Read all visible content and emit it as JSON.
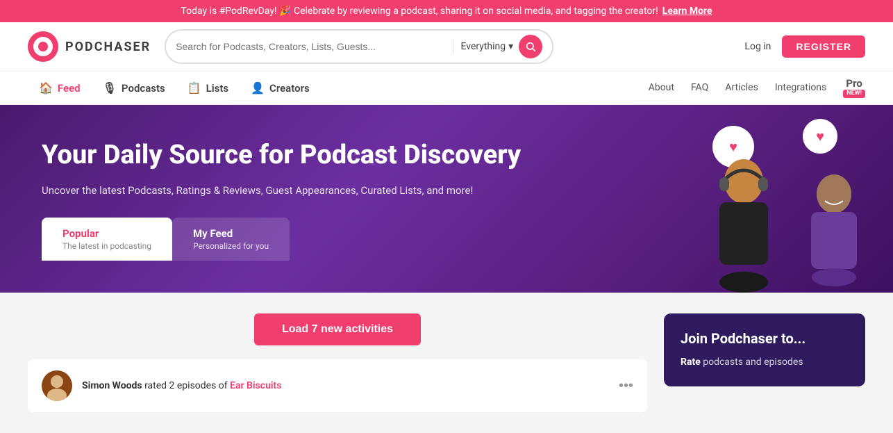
{
  "banner": {
    "text": "Today is #PodRevDay! 🎉 Celebrate by reviewing a podcast, sharing it on social media, and tagging the creator!",
    "link_text": "Learn More"
  },
  "header": {
    "logo_text": "PODCHASER",
    "search_placeholder": "Search for Podcasts, Creators, Lists, Guests...",
    "filter_label": "Everything",
    "login_label": "Log in",
    "register_label": "REGISTER"
  },
  "nav": {
    "items": [
      {
        "label": "Feed",
        "icon": "🏠"
      },
      {
        "label": "Podcasts",
        "icon": "🎙"
      },
      {
        "label": "Lists",
        "icon": "📋"
      },
      {
        "label": "Creators",
        "icon": "👤"
      }
    ],
    "right_links": [
      "About",
      "FAQ",
      "Articles",
      "Integrations"
    ],
    "pro_label": "Pro",
    "new_tag": "NEW!"
  },
  "hero": {
    "title": "Your Daily Source for Podcast Discovery",
    "subtitle": "Uncover the latest Podcasts, Ratings & Reviews, Guest Appearances, Curated Lists, and more!",
    "tabs": [
      {
        "label": "Popular",
        "sub": "The latest in podcasting",
        "active": true
      },
      {
        "label": "My Feed",
        "sub": "Personalized for you",
        "active": false
      }
    ]
  },
  "main": {
    "load_btn": "Load 7 new activities",
    "activity": {
      "user": "Simon Woods",
      "action": " rated 2 episodes of ",
      "target": "Ear Biscuits"
    }
  },
  "sidebar": {
    "join_title": "Join Podchaser to...",
    "join_desc_prefix": "Rate",
    "join_desc_suffix": " podcasts and episodes"
  }
}
